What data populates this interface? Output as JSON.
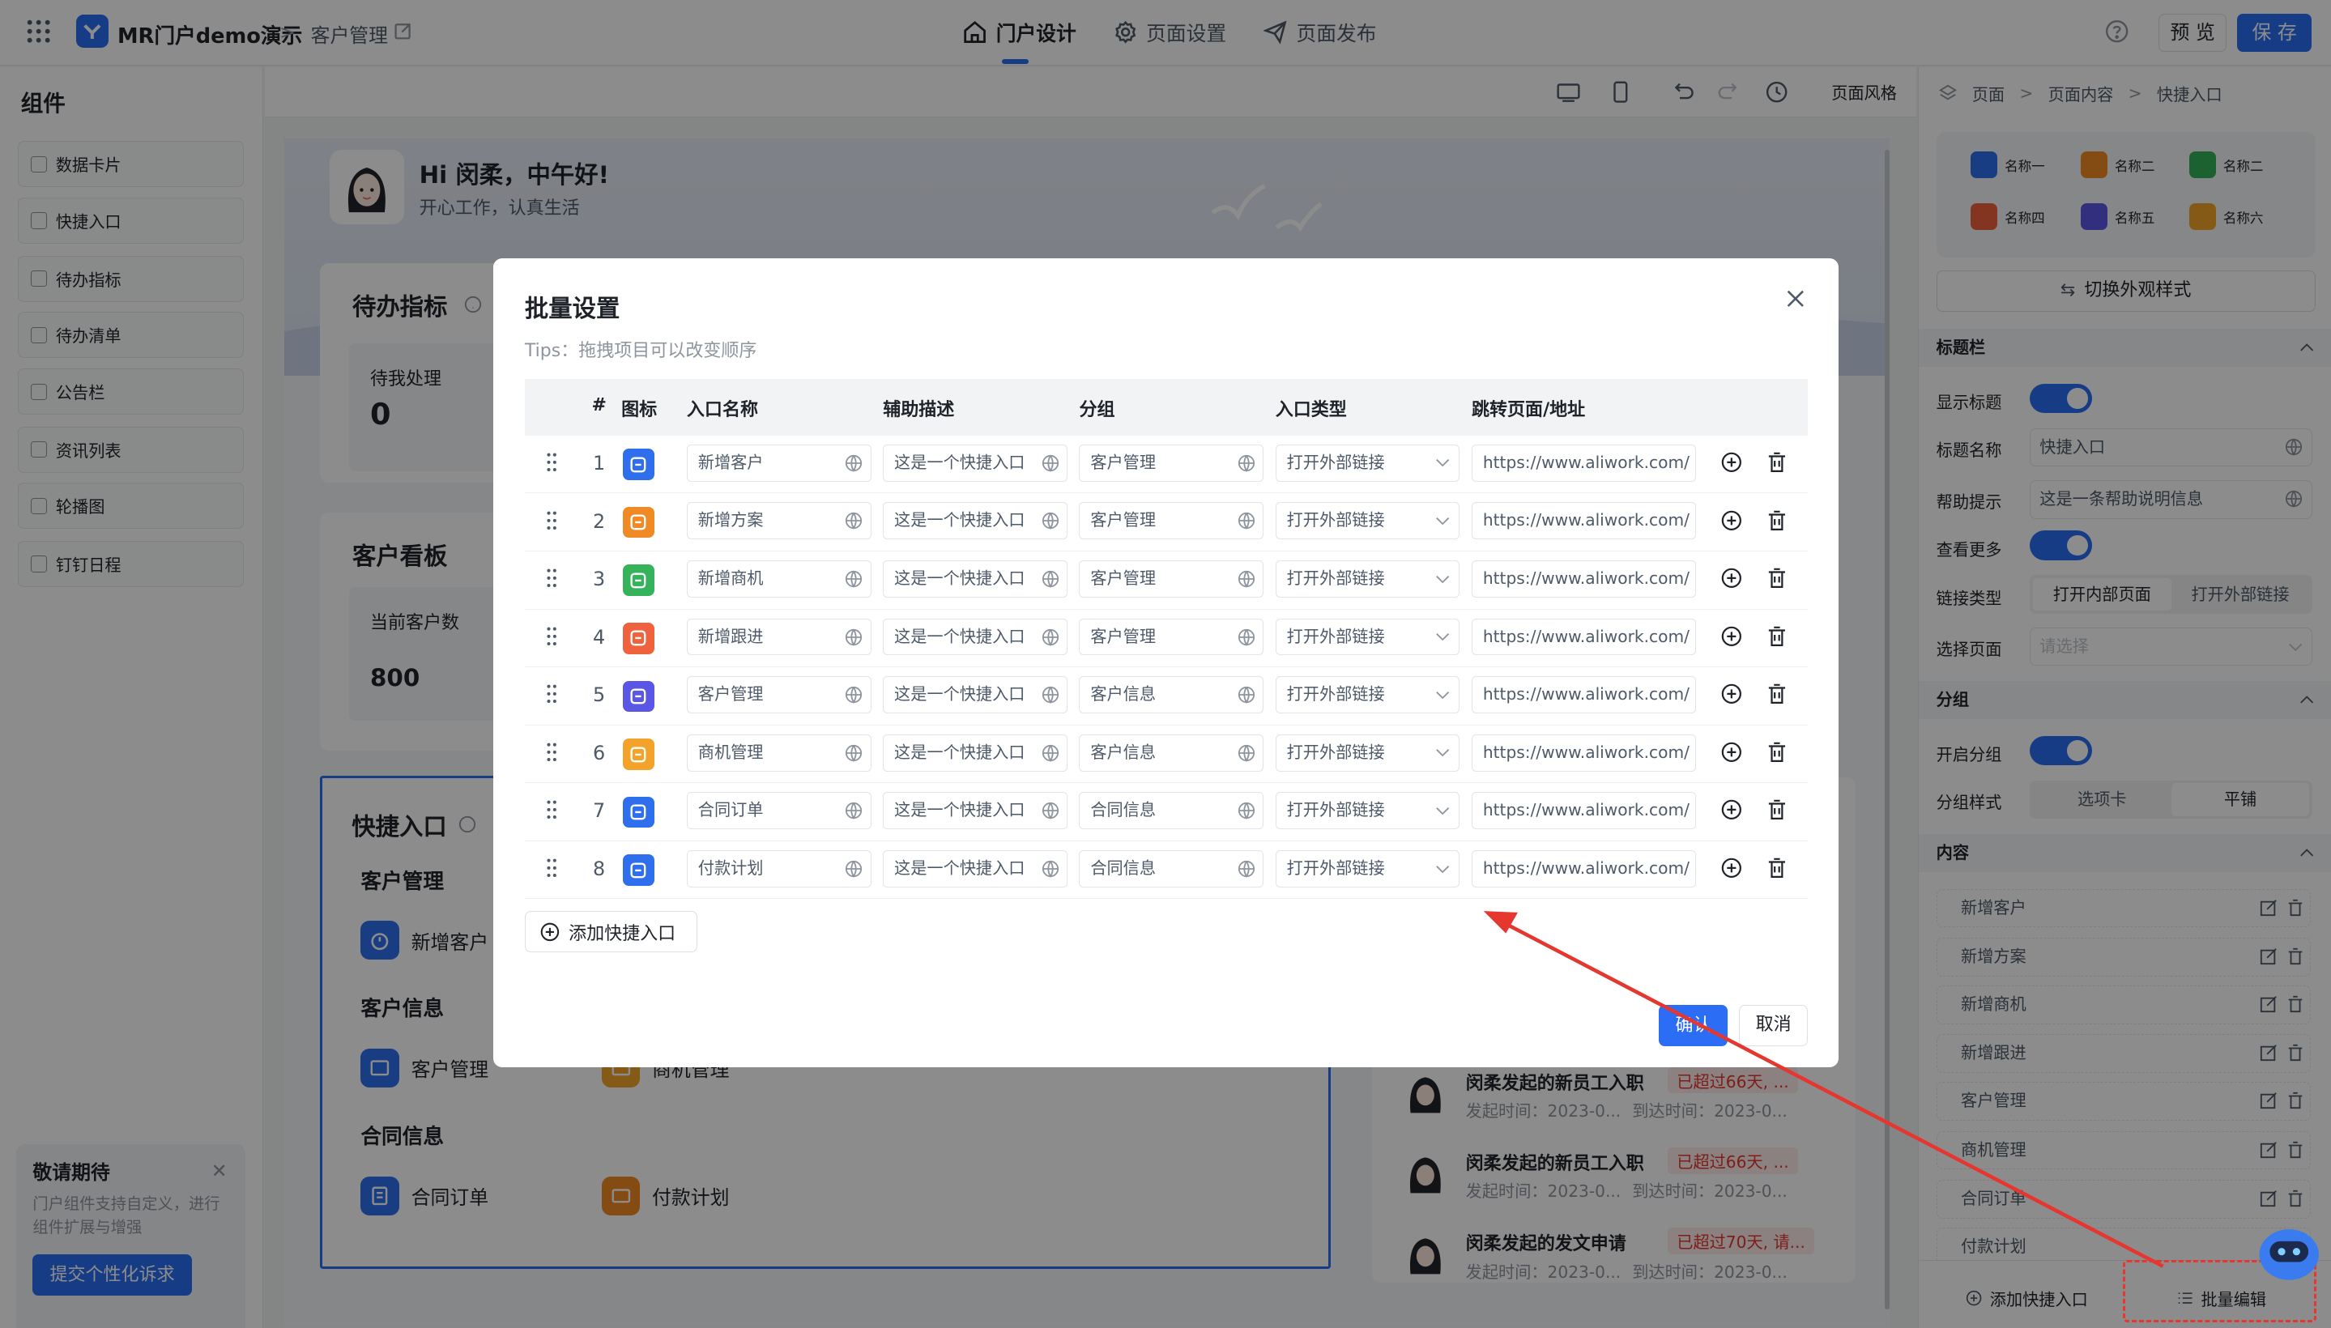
{
  "topbar": {
    "app_title": "MR门户demo演示",
    "crumb_sep": ">",
    "crumb": "客户管理",
    "tabs": [
      {
        "label": "门户设计"
      },
      {
        "label": "页面设置"
      },
      {
        "label": "页面发布"
      }
    ],
    "preview": "预 览",
    "save": "保 存"
  },
  "left": {
    "title": "组件",
    "components": [
      "数据卡片",
      "快捷入口",
      "待办指标",
      "待办清单",
      "公告栏",
      "资讯列表",
      "轮播图",
      "钉钉日程"
    ],
    "notice": {
      "title": "敬请期待",
      "close": "✕",
      "desc": "门户组件支持自定义，进行组件扩展与增强",
      "button": "提交个性化诉求"
    }
  },
  "canvas": {
    "page_style": "页面风格",
    "greeting": "Hi 闵柔，中午好!",
    "greeting_sub": "开心工作，认真生活",
    "todo_title": "待办指标",
    "todo_label": "待我处理",
    "todo_value": "0",
    "kanban_title": "客户看板",
    "kanban_label": "当前客户数",
    "kanban_value": "800",
    "quick_title": "快捷入口",
    "groups": [
      "客户管理",
      "客户信息",
      "合同信息"
    ],
    "quick_items": [
      "新增客户",
      "客户管理",
      "商机管理",
      "合同订单",
      "付款计划"
    ],
    "todo_items": [
      {
        "title": "闵柔发起的新员工入职",
        "badge": "已超过66天, ...",
        "meta1": "发起时间：2023-0...",
        "meta2": "到达时间：2023-0..."
      },
      {
        "title": "闵柔发起的新员工入职",
        "badge": "已超过66天, ...",
        "meta1": "发起时间：2023-0...",
        "meta2": "到达时间：2023-0..."
      },
      {
        "title": "闵柔发起的发文申请",
        "badge": "已超过70天, 请...",
        "meta1": "发起时间：2023-0...",
        "meta2": "到达时间：2023-0..."
      }
    ]
  },
  "right": {
    "crumbs": [
      "页面",
      "页面内容",
      "快捷入口"
    ],
    "style_items": [
      "名称一",
      "名称二",
      "名称二",
      "名称四",
      "名称五",
      "名称六"
    ],
    "switch_style": "切换外观样式",
    "sec_titlebar": "标题栏",
    "show_title": "显示标题",
    "title_name_label": "标题名称",
    "title_name_value": "快捷入口",
    "help_label": "帮助提示",
    "help_value": "这是一条帮助说明信息",
    "view_more": "查看更多",
    "link_type": "链接类型",
    "link_opts": [
      "打开内部页面",
      "打开外部链接"
    ],
    "choose_page": "选择页面",
    "choose_placeholder": "请选择",
    "sec_group": "分组",
    "enable_group": "开启分组",
    "group_style": "分组样式",
    "group_opts": [
      "选项卡",
      "平铺"
    ],
    "sec_content": "内容",
    "content_items": [
      "新增客户",
      "新增方案",
      "新增商机",
      "新增跟进",
      "客户管理",
      "商机管理",
      "合同订单",
      "付款计划"
    ],
    "add_entry": "添加快捷入口",
    "batch_edit": "批量编辑"
  },
  "modal": {
    "title": "批量设置",
    "tips": "Tips：拖拽项目可以改变顺序",
    "headers": [
      "#",
      "图标",
      "入口名称",
      "辅助描述",
      "分组",
      "入口类型",
      "跳转页面/地址"
    ],
    "rows": [
      {
        "no": "1",
        "name": "新增客户",
        "desc": "这是一个快捷入口",
        "group": "客户管理",
        "type": "打开外部链接",
        "url": "https://www.aliwork.com/",
        "color": "#2f6fed"
      },
      {
        "no": "2",
        "name": "新增方案",
        "desc": "这是一个快捷入口",
        "group": "客户管理",
        "type": "打开外部链接",
        "url": "https://www.aliwork.com/",
        "color": "#f08a24"
      },
      {
        "no": "3",
        "name": "新增商机",
        "desc": "这是一个快捷入口",
        "group": "客户管理",
        "type": "打开外部链接",
        "url": "https://www.aliwork.com/",
        "color": "#34b35a"
      },
      {
        "no": "4",
        "name": "新增跟进",
        "desc": "这是一个快捷入口",
        "group": "客户管理",
        "type": "打开外部链接",
        "url": "https://www.aliwork.com/",
        "color": "#f0623e"
      },
      {
        "no": "5",
        "name": "客户管理",
        "desc": "这是一个快捷入口",
        "group": "客户信息",
        "type": "打开外部链接",
        "url": "https://www.aliwork.com/",
        "color": "#5a57e6"
      },
      {
        "no": "6",
        "name": "商机管理",
        "desc": "这是一个快捷入口",
        "group": "客户信息",
        "type": "打开外部链接",
        "url": "https://www.aliwork.com/",
        "color": "#f3a329"
      },
      {
        "no": "7",
        "name": "合同订单",
        "desc": "这是一个快捷入口",
        "group": "合同信息",
        "type": "打开外部链接",
        "url": "https://www.aliwork.com/",
        "color": "#2f6fed"
      },
      {
        "no": "8",
        "name": "付款计划",
        "desc": "这是一个快捷入口",
        "group": "合同信息",
        "type": "打开外部链接",
        "url": "https://www.aliwork.com/",
        "color": "#2f6fed"
      }
    ],
    "add_button": "添加快捷入口",
    "ok": "确认",
    "cancel": "取消"
  },
  "colors": {
    "accent": "#2b6ef5",
    "annotation": "#e5362f",
    "badge_bg": "#fdecea",
    "badge_text": "#e5362f"
  }
}
